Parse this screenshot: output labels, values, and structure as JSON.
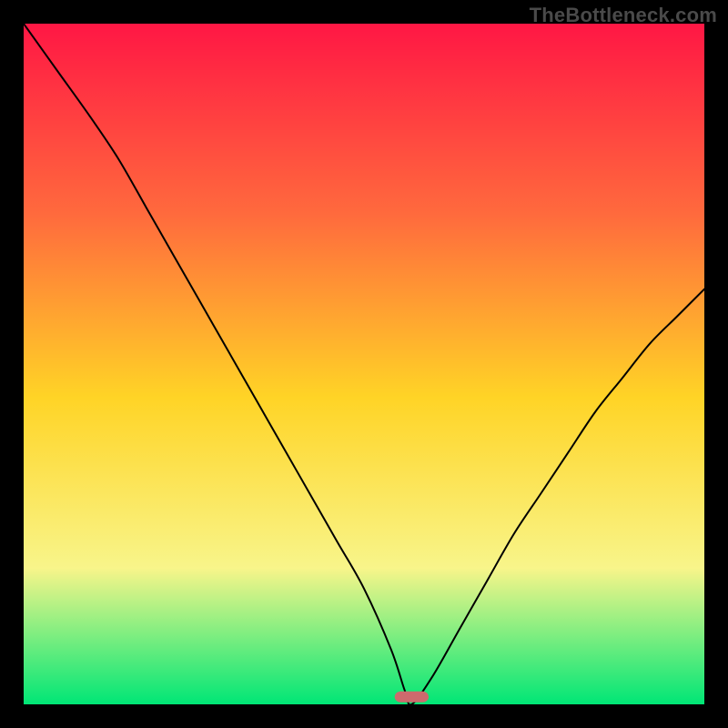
{
  "watermark": "TheBottleneck.com",
  "colors": {
    "background": "#000000",
    "gradient_top": "#ff1744",
    "gradient_mid_upper": "#ff6a3d",
    "gradient_mid": "#ffd426",
    "gradient_mid_lower": "#f8f58a",
    "gradient_bottom": "#00e676",
    "curve": "#000000",
    "marker_fill": "#ce6a6d",
    "watermark_text": "#4a4a4a"
  },
  "chart_data": {
    "type": "line",
    "title": "",
    "xlabel": "",
    "ylabel": "",
    "xlim": [
      0,
      100
    ],
    "ylim": [
      0,
      100
    ],
    "series": [
      {
        "name": "bottleneck-curve",
        "x": [
          0,
          5,
          10,
          14,
          18,
          22,
          26,
          30,
          34,
          38,
          42,
          46,
          50,
          54,
          56,
          57,
          60,
          64,
          68,
          72,
          76,
          80,
          84,
          88,
          92,
          96,
          100
        ],
        "y": [
          100,
          93,
          86,
          80,
          73,
          66,
          59,
          52,
          45,
          38,
          31,
          24,
          17,
          8,
          2,
          0,
          4,
          11,
          18,
          25,
          31,
          37,
          43,
          48,
          53,
          57,
          61
        ]
      }
    ],
    "marker": {
      "x_center": 57,
      "width_pct": 5,
      "height_pct": 1.6
    }
  }
}
